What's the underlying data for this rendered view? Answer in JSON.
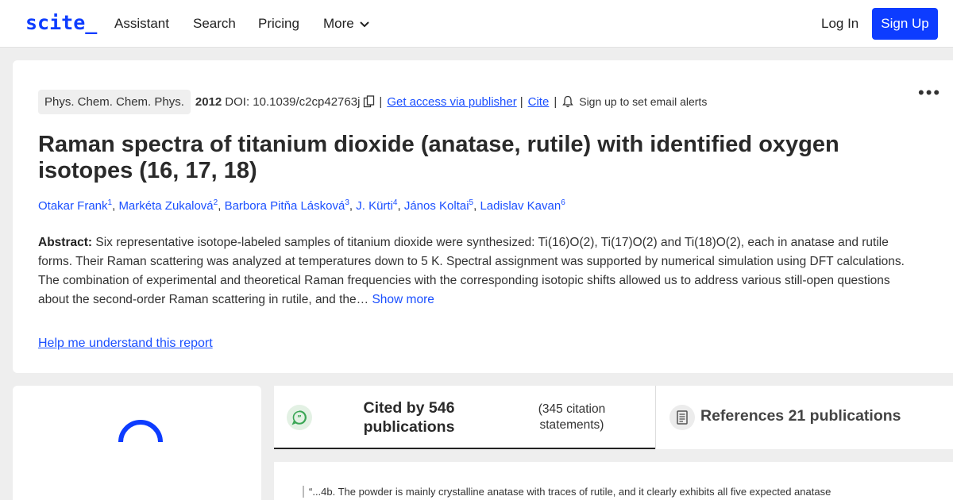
{
  "nav": {
    "logo": "scite_",
    "links": [
      "Assistant",
      "Search",
      "Pricing"
    ],
    "more": "More",
    "login": "Log In",
    "signup": "Sign Up"
  },
  "paper": {
    "journal": "Phys. Chem. Chem. Phys.",
    "year": "2012",
    "doi": "DOI: 10.1039/c2cp42763j",
    "access": "Get access via publisher",
    "cite": "Cite",
    "alerts": "Sign up to set email alerts",
    "title": "Raman spectra of titanium dioxide (anatase, rutile) with identified oxygen isotopes (16, 17, 18)",
    "authors": [
      {
        "name": "Otakar Frank",
        "n": "1"
      },
      {
        "name": "Markéta Zukalová",
        "n": "2"
      },
      {
        "name": "Barbora Pitňa Lásková",
        "n": "3"
      },
      {
        "name": "J. Kürti",
        "n": "4"
      },
      {
        "name": "János Koltai",
        "n": "5"
      },
      {
        "name": "Ladislav Kavan",
        "n": "6"
      }
    ],
    "abstract_label": "Abstract:",
    "abstract": "Six representative isotope-labeled samples of titanium dioxide were synthesized: Ti(16)O(2), Ti(17)O(2) and Ti(18)O(2), each in anatase and rutile forms. Their Raman scattering was analyzed at temperatures down to 5 K. Spectral assignment was supported by numerical simulation using DFT calculations. The combination of experimental and theoretical Raman frequencies with the corresponding isotopic shifts allowed us to address various still-open questions about the second-order Raman scattering in rutile, and the…",
    "show_more": "Show more",
    "help": "Help me understand this report"
  },
  "tabs": {
    "cited_by": "Cited by 546 publications",
    "citation_statements": "(345 citation statements)",
    "references": "References 21 publications"
  },
  "snippet": {
    "text": "“...4b. The powder is mainly crystalline anatase with traces of rutile, and it clearly exhibits all five expected anatase"
  },
  "colors": {
    "accent": "#0d3cff",
    "link": "#1a4fff",
    "cite_icon": "#3aa655"
  }
}
